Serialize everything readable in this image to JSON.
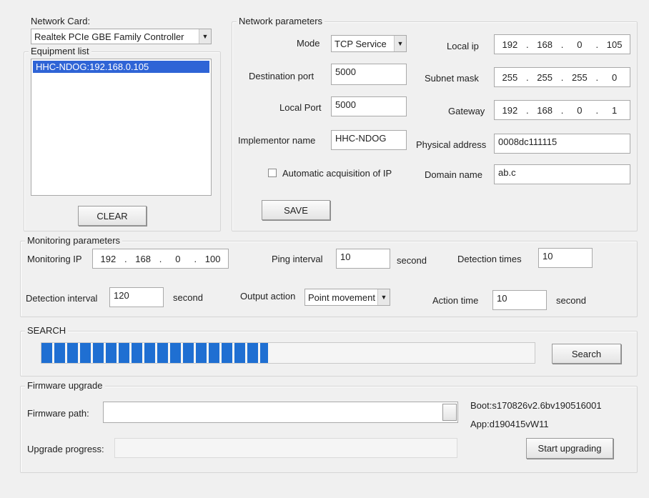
{
  "network_card": {
    "label": "Network Card:",
    "selected": "Realtek PCIe GBE Family Controller"
  },
  "equipment_list": {
    "title": "Equipment list",
    "items": [
      "HHC-NDOG:192.168.0.105"
    ],
    "clear_label": "CLEAR"
  },
  "network_params": {
    "title": "Network parameters",
    "mode_label": "Mode",
    "mode_value": "TCP Service",
    "destination_port_label": "Destination port",
    "destination_port": "5000",
    "local_port_label": "Local Port",
    "local_port": "5000",
    "implementor_label": "Implementor name",
    "implementor": "HHC-NDOG",
    "auto_acq_label": "Automatic acquisition of IP",
    "local_ip_label": "Local ip",
    "local_ip": [
      "192",
      "168",
      "0",
      "105"
    ],
    "subnet_label": "Subnet mask",
    "subnet": [
      "255",
      "255",
      "255",
      "0"
    ],
    "gateway_label": "Gateway",
    "gateway": [
      "192",
      "168",
      "0",
      "1"
    ],
    "physical_label": "Physical address",
    "physical": "0008dc111115",
    "domain_label": "Domain name",
    "domain": "ab.c",
    "save_label": "SAVE"
  },
  "monitoring": {
    "title": "Monitoring parameters",
    "ip_label": "Monitoring IP",
    "ip": [
      "192",
      "168",
      "0",
      "100"
    ],
    "ping_label": "Ping  interval",
    "ping_value": "10",
    "second_label": "second",
    "detect_times_label": "Detection times",
    "detect_times": "10",
    "detect_interval_label": "Detection interval",
    "detect_interval": "120",
    "output_label": "Output action",
    "output_value": "Point movement",
    "action_time_label": "Action time",
    "action_time": "10"
  },
  "search": {
    "title": "SEARCH",
    "progress_fraction": 0.46,
    "button_label": "Search"
  },
  "firmware": {
    "title": "Firmware upgrade",
    "path_label": "Firmware path:",
    "path_value": "",
    "boot_text": "Boot:s170826v2.6bv190516001",
    "app_text": "App:d190415vW11",
    "progress_label": "Upgrade progress:",
    "start_label": "Start upgrading"
  }
}
